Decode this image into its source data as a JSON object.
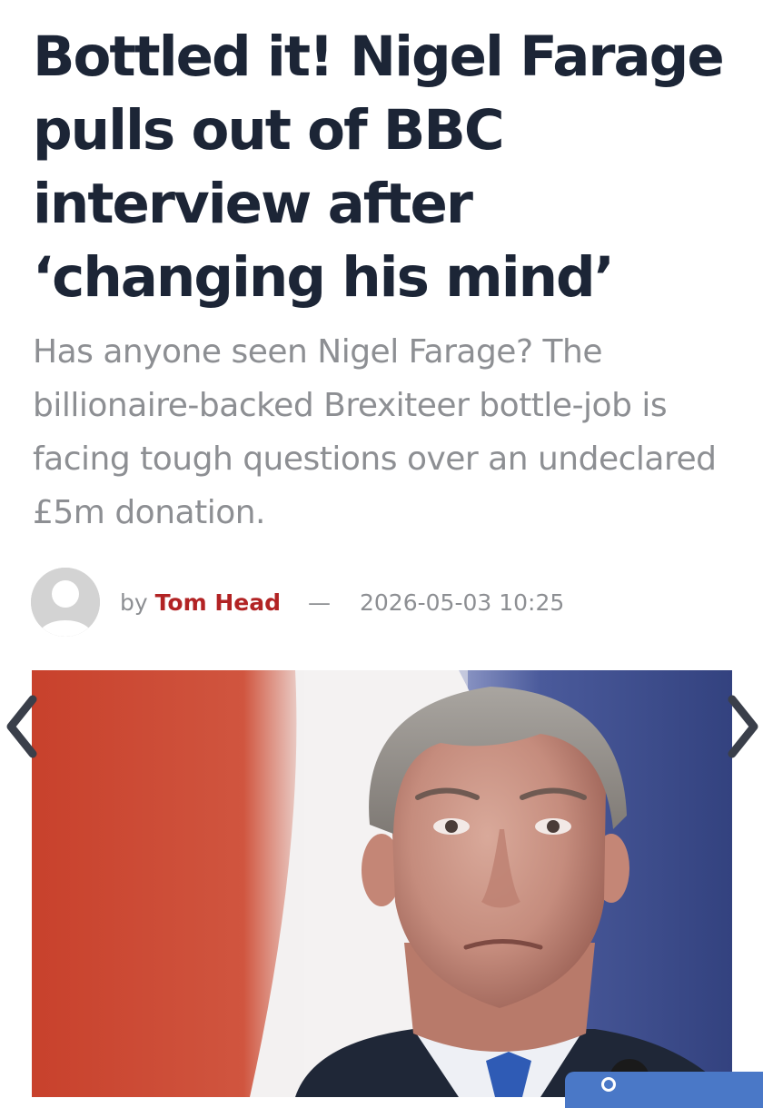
{
  "article": {
    "headline": "Bottled it! Nigel Farage pulls out of BBC interview after ‘changing his mind’",
    "standfirst": "Has anyone seen Nigel Farage? The billionaire-backed Brexiteer bottle-job is facing tough questions over an undeclared £5m donation.",
    "byline": {
      "by": "by",
      "author": "Tom Head",
      "separator": "—",
      "date": "2026-05-03 10:25"
    }
  },
  "gallery": {
    "prev_icon": "chevron-left-icon",
    "next_icon": "chevron-right-icon"
  },
  "colors": {
    "headline": "#1c2536",
    "standfirst": "#8d8f93",
    "author_link": "#b22324",
    "corner_tab": "#4a78c7",
    "backdrop_red": "#c8402c",
    "backdrop_blue": "#3c4c8e"
  }
}
